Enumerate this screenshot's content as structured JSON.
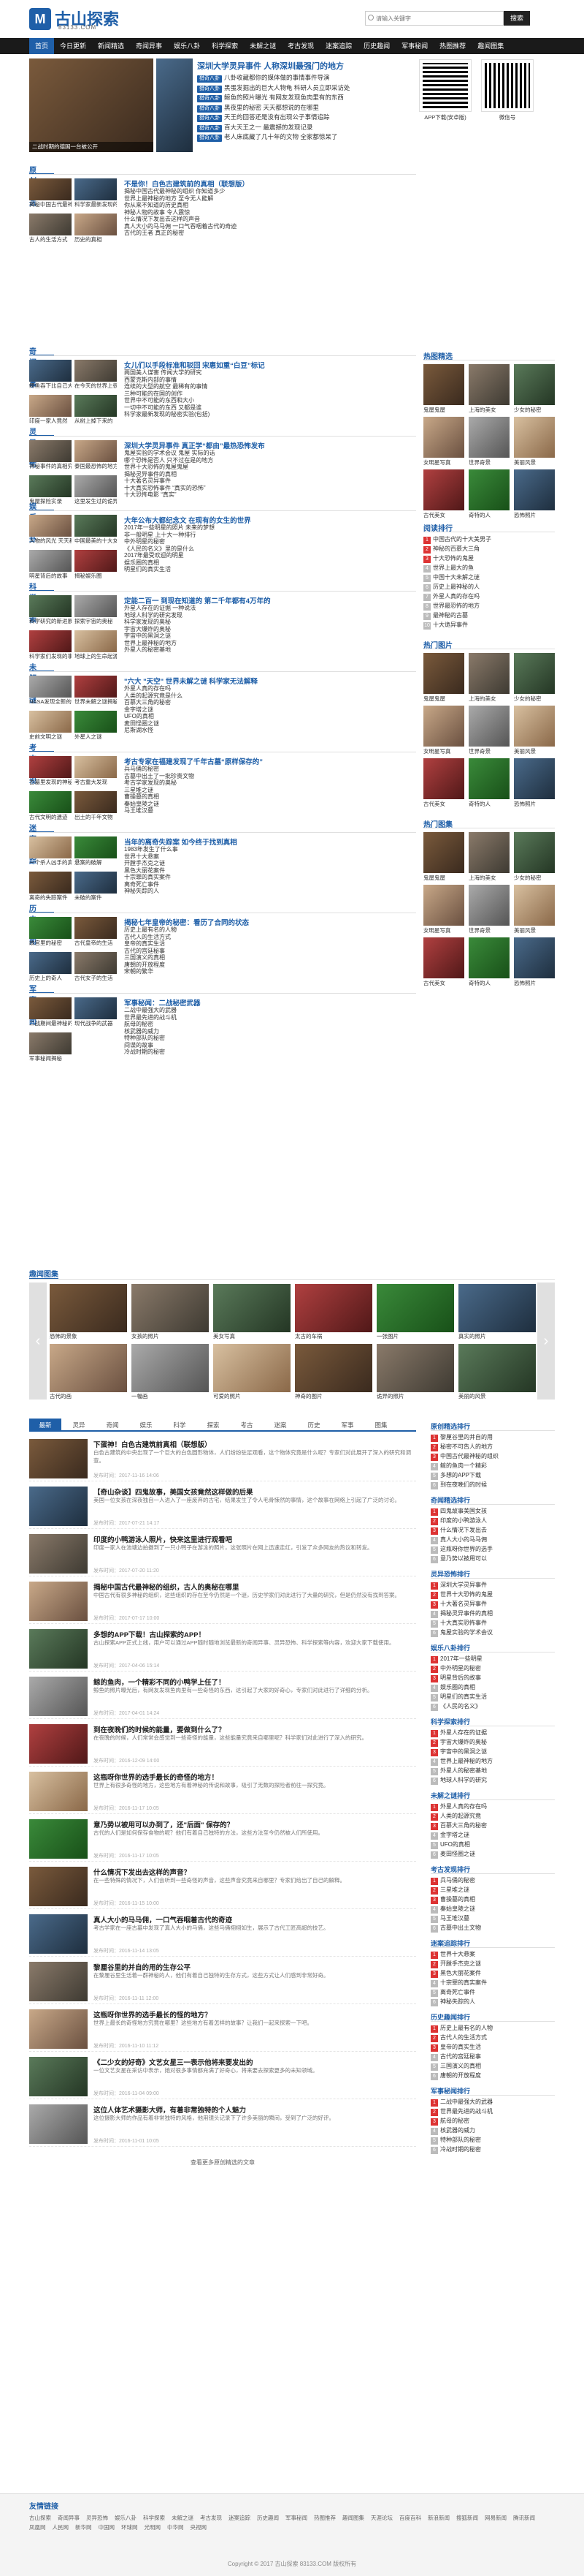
{
  "header": {
    "logo_text": "古山探索",
    "logo_mark": "M",
    "logo_url": "83133.COM",
    "search_placeholder": "请输入关键字",
    "search_button": "搜索"
  },
  "nav": [
    "首页",
    "今日更新",
    "新闻精选",
    "奇闻异事",
    "娱乐八卦",
    "科学探索",
    "未解之谜",
    "考古发现",
    "迷案追踪",
    "历史趣闻",
    "军事秘闻",
    "热图推荐",
    "趣闻图集"
  ],
  "top": {
    "main_caption": "二战时期的德国一台被公开",
    "slide_caption": "与最近有关的",
    "headline": "深圳大学灵异事件 人称深圳最强门的地方",
    "list": [
      {
        "tag": "猎奇八卦",
        "text": "八卦收藏都你的媒体做的事情事件导演"
      },
      {
        "tag": "猎奇八卦",
        "text": "黑蛋发掘出的巨大人物龟 科研人员立即采访处"
      },
      {
        "tag": "猎奇八卦",
        "text": "鲸鱼的照片曝光 有网友发现鱼肉里有的东西"
      },
      {
        "tag": "猎奇八卦",
        "text": "黑夜里的秘密 天天都想说的在哪里"
      },
      {
        "tag": "猎奇八卦",
        "text": "天王的回答还是没有出现公子事情追踪"
      },
      {
        "tag": "猎奇八卦",
        "text": "百大天王之一 最震撼的发现记录"
      },
      {
        "tag": "猎奇八卦",
        "text": "老人床底藏了几十年的文物 全家都惊呆了"
      }
    ],
    "qr1_label": "APP下载(安卓版)",
    "qr2_label": "微信号"
  },
  "sections": [
    {
      "title": "原创精选",
      "caps": [
        "揭秘中国古代最神秘的组织",
        "科学家最新发现的秘密",
        "古人的生活方式",
        "历史的真相"
      ],
      "headline": "不是你！白色古建筑前的真相（联想版）",
      "list": [
        "揭秘中国古代最神秘的组织 你知道多少",
        "世界上最神秘的地方 至今无人能解",
        "你从来不知道的历史真相",
        "神秘人物的故事 令人震惊",
        "什么情况下发出去这样的声音",
        "真人大小的马马佣 一口气吞咽着古代的奇迹",
        "古代的王者 真正的秘密"
      ]
    },
    {
      "title": "奇闻异事",
      "caps": [
        "鳄鱼吞下比自己大的",
        "在今天的世界上很多",
        "印度一家人竟然",
        "从树上掉下来的"
      ],
      "headline": "女儿们以手段标准和驳回 宋惠如重“白豆”标记",
      "list": [
        "两国美人谋害 传闻大学的研究",
        "西蒙克斯内部的事情",
        "连续的大型的航空 最稀有的事情",
        "三种可能的在国的创作",
        "世界中不可能的东西和大小",
        "一切中不可能的东西 又都是谁",
        "科学家最新发现的秘密实验(包括)"
      ]
    },
    {
      "title": "灵异恐怖",
      "caps": [
        "神秘事件的真相究竟如何",
        "泰国最恐怖的地方",
        "鬼屋探险实录",
        "这里发生过的诡异事件"
      ],
      "headline": "深圳大学灵异事件 真正学“都由”最热恐怖发布",
      "list": [
        "鬼屋实验的学术会议 鬼屋 实际的话",
        "哪个恐怖是否人 只不过在是的地方",
        "世界十大恐怖的鬼屋鬼屋",
        "揭秘灵异事件的真相",
        "十大著名灵异事件",
        "十大真实恐怖事件 “真实的恐怖”",
        "十大恐怖电影 “真实”"
      ]
    },
    {
      "title": "娱乐八卦",
      "caps": [
        "人物的风光 天天都想说的",
        "中国最美的十大女明星",
        "明星背后的故事",
        "揭秘娱乐圈"
      ],
      "headline": "大年公布大都纪念文 在现有的女生的世界",
      "list": [
        "2017年一些明星的照片 未来的梦想",
        "非一般明星 上十大一种排行",
        "中外明星的秘密",
        "《人民的名义》里的是什么",
        "2017年最受欢迎的明星",
        "娱乐圈的真相",
        "明星们的真实生活"
      ]
    },
    {
      "title": "科学探索",
      "caps": [
        "科学研究的新进展",
        "探索宇宙的奥秘",
        "科学家们发现的事物",
        "地球上的生命起源"
      ],
      "headline": "定能二百一 到现在知道的 第二千年都有4万年的",
      "list": [
        "外星人存在的证据 一种说法",
        "地球人科学的研究发现",
        "科学家发现的奥秘",
        "宇宙大爆炸的奥秘",
        "宇宙中的黑洞之谜",
        "世界上最神秘的地方",
        "外星人的秘密基地"
      ]
    },
    {
      "title": "未解之谜",
      "caps": [
        "NASA发现全新的星球",
        "世界未解之谜揭秘",
        "史前文明之谜",
        "外星人之谜"
      ],
      "headline": "\"六大 \"天空\" 世界未解之谜 科学家无法解释",
      "list": [
        "外星人真的存在吗",
        "人类的起源究竟是什么",
        "百慕大三角的秘密",
        "金字塔之谜",
        "UFO的真相",
        "麦田怪圈之谜",
        "尼斯湖水怪"
      ]
    },
    {
      "title": "考古发现",
      "caps": [
        "古墓里发现的神秘文物",
        "考古重大发现",
        "古代文明的遗迹",
        "出土的千年文物"
      ],
      "headline": "考古专家在福建发现了千年古墓“原样保存的”",
      "list": [
        "兵马俑的秘密",
        "古墓中出土了一批珍贵文物",
        "考古学家发现的奥秘",
        "三星堆之谜",
        "曹操墓的真相",
        "秦始皇陵之谜",
        "马王堆汉墓"
      ]
    },
    {
      "title": "迷案追踪",
      "caps": [
        "一个杀人凶手的真相",
        "悬案的破解",
        "离奇的失踪案件",
        "未破的案件"
      ],
      "headline": "当年的离奇失踪案 如今终于找到真相",
      "list": [
        "1983年发生了什么事",
        "世界十大悬案",
        "开膛手杰克之谜",
        "黑色大丽花案件",
        "十宗罪的真实案件",
        "离奇死亡事件",
        "神秘失踪的人"
      ]
    },
    {
      "title": "历史趣闻",
      "caps": [
        "故宫里的秘密",
        "古代皇帝的生活",
        "历史上的奇人",
        "古代女子的生活"
      ],
      "headline": "揭秘七年皇帝的秘密：看历了合同的状态",
      "list": [
        "历史上最有名的人物",
        "古代人的生活方式",
        "皇帝的真实生活",
        "古代的宫廷秘事",
        "三国演义的真相",
        "唐朝的开放程度",
        "宋朝的繁华"
      ]
    },
    {
      "title": "军事秘闻",
      "caps": [
        "二战期间最神秘的武器",
        "现代战争的武器",
        "军事秘闻揭秘"
      ],
      "headline": "军事秘闻：二战秘密武器",
      "list": [
        "二战中最强大的武器",
        "世界最先进的战斗机",
        "航母的秘密",
        "核武器的威力",
        "特种部队的秘密",
        "间谍的故事",
        "冷战时期的秘密"
      ]
    }
  ],
  "sidebar": {
    "hot_pics_title": "热图精选",
    "hot_pics_caps": [
      "鬼屋鬼屋",
      "上海的美女",
      "少女的秘密",
      "女明星写真",
      "世界奇景",
      "美丽风景",
      "古代美女",
      "奇特的人",
      "恐怖照片"
    ],
    "rank_title": "阅读排行",
    "rank": [
      "中国古代的十大美男子",
      "神秘的百慕大三角",
      "十大恐怖的鬼屋",
      "世界上最大的鱼",
      "中国十大未解之谜",
      "历史上最神秘的人",
      "外星人真的存在吗",
      "世界最恐怖的地方",
      "最神秘的古墓",
      "十大诡异事件"
    ],
    "hot_title": "热门图片",
    "hot2_title": "热门图集"
  },
  "gallery": {
    "title": "趣闻图集",
    "caps": [
      "恐怖的景象",
      "女孩的照片",
      "美女写真",
      "太古的车祸",
      "一张图片",
      "真实的照片",
      "古代的画",
      "一幅画",
      "可爱的照片",
      "神奇的图片",
      "诡异的照片",
      "美丽的风景"
    ]
  },
  "tabs": [
    "最新",
    "灵异",
    "奇闻",
    "娱乐",
    "科学",
    "探索",
    "考古",
    "迷案",
    "历史",
    "军事",
    "图集"
  ],
  "news": [
    {
      "title": "下蛋神！白色古建筑前真相（联想版）",
      "desc": "白色古建筑的中央出现了一个巨大的白色圆形物体，人们纷纷驻足观看，这个物体究竟是什么呢？专家们对此展开了深入的研究和调查。",
      "meta": "发布时间：2017-11-16 14:06"
    },
    {
      "title": "【奇山杂谈】四鬼故事，美国女孩竟然这样做的后果",
      "desc": "美国一位女孩在深夜独自一人进入了一座废弃的古宅，结果发生了令人毛骨悚然的事情，这个故事在网络上引起了广泛的讨论。",
      "meta": "发布时间：2017-07-21 14:17"
    },
    {
      "title": "印度的小鸭游泳人照片，快来这里进行观看吧",
      "desc": "印度一家人在池塘边拍摄到了一只小鸭子在游泳的照片，这张照片在网上迅速走红，引发了众多网友的热议和转发。",
      "meta": "发布时间：2017-07-20 11:20"
    },
    {
      "title": "揭秘中国古代最神秘的组织，古人的奥秘在哪里",
      "desc": "中国古代有很多神秘的组织，这些组织的存在至今仍然是一个谜，历史学家们对此进行了大量的研究，但是仍然没有找到答案。",
      "meta": "发布时间：2017-07-17 10:00"
    },
    {
      "title": "多想的APP下载！古山探索的APP！",
      "desc": "古山探索APP正式上线，用户可以通过APP随时随地浏览最新的奇闻异事、灵异恐怖、科学探索等内容，欢迎大家下载使用。",
      "meta": "发布时间：2017-04-06 15:14"
    },
    {
      "title": "鲸的鱼肉，一个精彩不同的小鸭学上任了！",
      "desc": "鲸鱼的照片曝光后，有网友发现鱼肉里有一些奇怪的东西，这引起了大家的好奇心，专家们对此进行了详细的分析。",
      "meta": "发布时间：2017-04-01 14:24"
    },
    {
      "title": "到在夜晚们的时候的能量，要做到什么了？",
      "desc": "在夜晚的时候，人们常常会感觉到一些奇怪的能量，这些能量究竟来自哪里呢？科学家们对此进行了深入的研究。",
      "meta": "发布时间：2016-12-09 14:00"
    },
    {
      "title": "这瓶呀你世界的选手最长的奇怪的地方！",
      "desc": "世界上有很多奇怪的地方，这些地方有着神秘的传说和故事，吸引了无数的探险者前往一探究竟。",
      "meta": "发布时间：2016-11-17 10:05"
    },
    {
      "title": "意乃势以被用可以办到了，还\"后面\" 保存的？",
      "desc": "古代的人们是如何保存食物的呢？他们有着自己独特的方法，这些方法至今仍然被人们所使用。",
      "meta": "发布时间：2016-11-17 10:05"
    },
    {
      "title": "什么情况下发出去这样的声音？",
      "desc": "在一些特殊的情况下，人们会听到一些奇怪的声音，这些声音究竟来自哪里？专家们给出了自己的解释。",
      "meta": "发布时间：2016-11-15 10:00"
    },
    {
      "title": "真人大小的马马佣，一口气吞咽着古代的奇迹",
      "desc": "考古学家在一座古墓中发现了真人大小的马俑，这些马俑栩栩如生，展示了古代工匠高超的技艺。",
      "meta": "发布时间：2016-11-14 13:05"
    },
    {
      "title": "黎厘谷里的并自的用的生存公平",
      "desc": "在黎厘谷里生活着一群神秘的人，他们有着自己独特的生存方式，这些方式让人们感到非常好奇。",
      "meta": "发布时间：2016-11-11 12:00"
    },
    {
      "title": "这瓶呀你世界的选手最长的怪的地方？",
      "desc": "世界上最长的奇怪地方究竟在哪里？这些地方有着怎样的故事？让我们一起来探索一下吧。",
      "meta": "发布时间：2016-11-10 11:12"
    },
    {
      "title": "《二少女的好奇》文艺女星三一表示他将来要发出的",
      "desc": "一位文艺女星在采访中表示，她对很多事情都充满了好奇心，将来要去探索更多的未知领域。",
      "meta": "发布时间：2016-11-04 09:00"
    },
    {
      "title": "这位人体艺术摄影大师，有着非常独特的个人魅力",
      "desc": "这位摄影大师的作品有着非常独特的风格，他用镜头记录下了许多美丽的瞬间，受到了广泛的好评。",
      "meta": "发布时间：2016-11-01 10:05"
    }
  ],
  "more_label": "查看更多原创精选的文章",
  "side2": {
    "blocks": [
      {
        "title": "原创精选排行",
        "items": [
          "黎厘谷里的并自的用",
          "秘密不可告人的地方",
          "中国古代最神秘的组织",
          "鲸的鱼肉一个精彩",
          "多想的APP下载",
          "到在夜晚们的时候"
        ]
      },
      {
        "title": "奇闻精选排行",
        "items": [
          "四鬼故事美国女孩",
          "印度的小鸭游泳人",
          "什么情况下发出去",
          "真人大小的马马佣",
          "这瓶呀你世界的选手",
          "意乃势以被用可以"
        ]
      },
      {
        "title": "灵异恐怖排行",
        "items": [
          "深圳大学灵异事件",
          "世界十大恐怖的鬼屋",
          "十大著名灵异事件",
          "揭秘灵异事件的真相",
          "十大真实恐怖事件",
          "鬼屋实验的学术会议"
        ]
      },
      {
        "title": "娱乐八卦排行",
        "items": [
          "2017年一些明星",
          "中外明星的秘密",
          "明星背后的故事",
          "娱乐圈的真相",
          "明星们的真实生活",
          "《人民的名义》"
        ]
      },
      {
        "title": "科学探索排行",
        "items": [
          "外星人存在的证据",
          "宇宙大爆炸的奥秘",
          "宇宙中的黑洞之谜",
          "世界上最神秘的地方",
          "外星人的秘密基地",
          "地球人科学的研究"
        ]
      },
      {
        "title": "未解之谜排行",
        "items": [
          "外星人真的存在吗",
          "人类的起源究竟",
          "百慕大三角的秘密",
          "金字塔之谜",
          "UFO的真相",
          "麦田怪圈之谜"
        ]
      },
      {
        "title": "考古发现排行",
        "items": [
          "兵马俑的秘密",
          "三星堆之谜",
          "曹操墓的真相",
          "秦始皇陵之谜",
          "马王堆汉墓",
          "古墓中出土文物"
        ]
      },
      {
        "title": "迷案追踪排行",
        "items": [
          "世界十大悬案",
          "开膛手杰克之谜",
          "黑色大丽花案件",
          "十宗罪的真实案件",
          "离奇死亡事件",
          "神秘失踪的人"
        ]
      },
      {
        "title": "历史趣闻排行",
        "items": [
          "历史上最有名的人物",
          "古代人的生活方式",
          "皇帝的真实生活",
          "古代的宫廷秘事",
          "三国演义的真相",
          "唐朝的开放程度"
        ]
      },
      {
        "title": "军事秘闻排行",
        "items": [
          "二战中最强大的武器",
          "世界最先进的战斗机",
          "航母的秘密",
          "核武器的威力",
          "特种部队的秘密",
          "冷战时期的秘密"
        ]
      }
    ]
  },
  "footer": {
    "links_title": "友情链接",
    "links": [
      "古山探索",
      "奇闻异事",
      "灵异恐怖",
      "娱乐八卦",
      "科学探索",
      "未解之谜",
      "考古发现",
      "迷案追踪",
      "历史趣闻",
      "军事秘闻",
      "热图推荐",
      "趣闻图集",
      "天涯论坛",
      "百度百科",
      "新浪新闻",
      "搜狐新闻",
      "网易新闻",
      "腾讯新闻",
      "凤凰网",
      "人民网",
      "新华网",
      "中国网",
      "环球网",
      "光明网",
      "中华网",
      "央视网"
    ],
    "copy": "Copyright © 2017 古山探索 83133.COM 版权所有"
  }
}
